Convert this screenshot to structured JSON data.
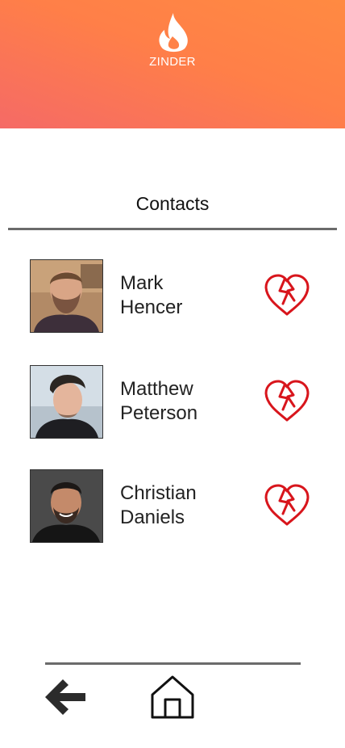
{
  "app": {
    "brand": "ZINDER"
  },
  "contacts": {
    "title": "Contacts",
    "items": [
      {
        "first": "Mark",
        "last": "Hencer"
      },
      {
        "first": "Matthew",
        "last": "Peterson"
      },
      {
        "first": "Christian",
        "last": "Daniels"
      }
    ]
  },
  "icons": {
    "logo": "flame-icon",
    "unmatch": "broken-heart-icon",
    "back": "arrow-left-icon",
    "home": "home-icon"
  },
  "colors": {
    "header_start": "#ff8a42",
    "header_end": "#f56a66",
    "heart": "#d8151c"
  }
}
